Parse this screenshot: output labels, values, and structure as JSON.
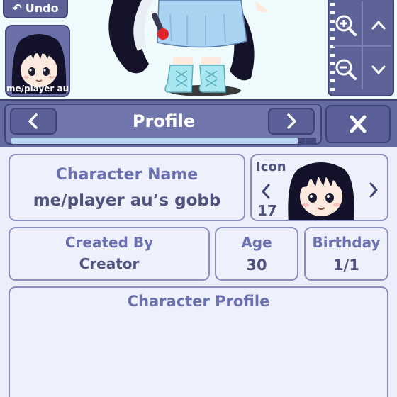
{
  "toolbar": {
    "undo_label": "Undo"
  },
  "character_thumb": {
    "label": "me/player au'"
  },
  "zoom_controls": [
    "zoom-in",
    "scroll-up",
    "zoom-out",
    "scroll-down"
  ],
  "profile_header": {
    "title": "Profile",
    "progress_fraction": 0.94
  },
  "fields": {
    "character_name_label": "Character Name",
    "character_name_value": "me/player au’s gobb",
    "icon_label": "Icon",
    "icon_number": "17",
    "created_by_label": "Created By",
    "created_by_value": "Creator",
    "age_label": "Age",
    "age_value": "30",
    "birthday_label": "Birthday",
    "birthday_value": "1/1",
    "character_profile_label": "Character Profile"
  },
  "colors": {
    "panel": "#636aa0",
    "panel_border": "#3d4374",
    "card_bg": "#eef0fb",
    "label_text": "#6b71b0",
    "value_text": "#4e527c",
    "progress_fill": "#b8d6f0"
  },
  "icons": [
    "undo-icon",
    "zoom-in-icon",
    "zoom-out-icon",
    "chevron-up-icon",
    "chevron-down-icon",
    "chevron-left-icon",
    "chevron-right-icon",
    "close-icon"
  ]
}
